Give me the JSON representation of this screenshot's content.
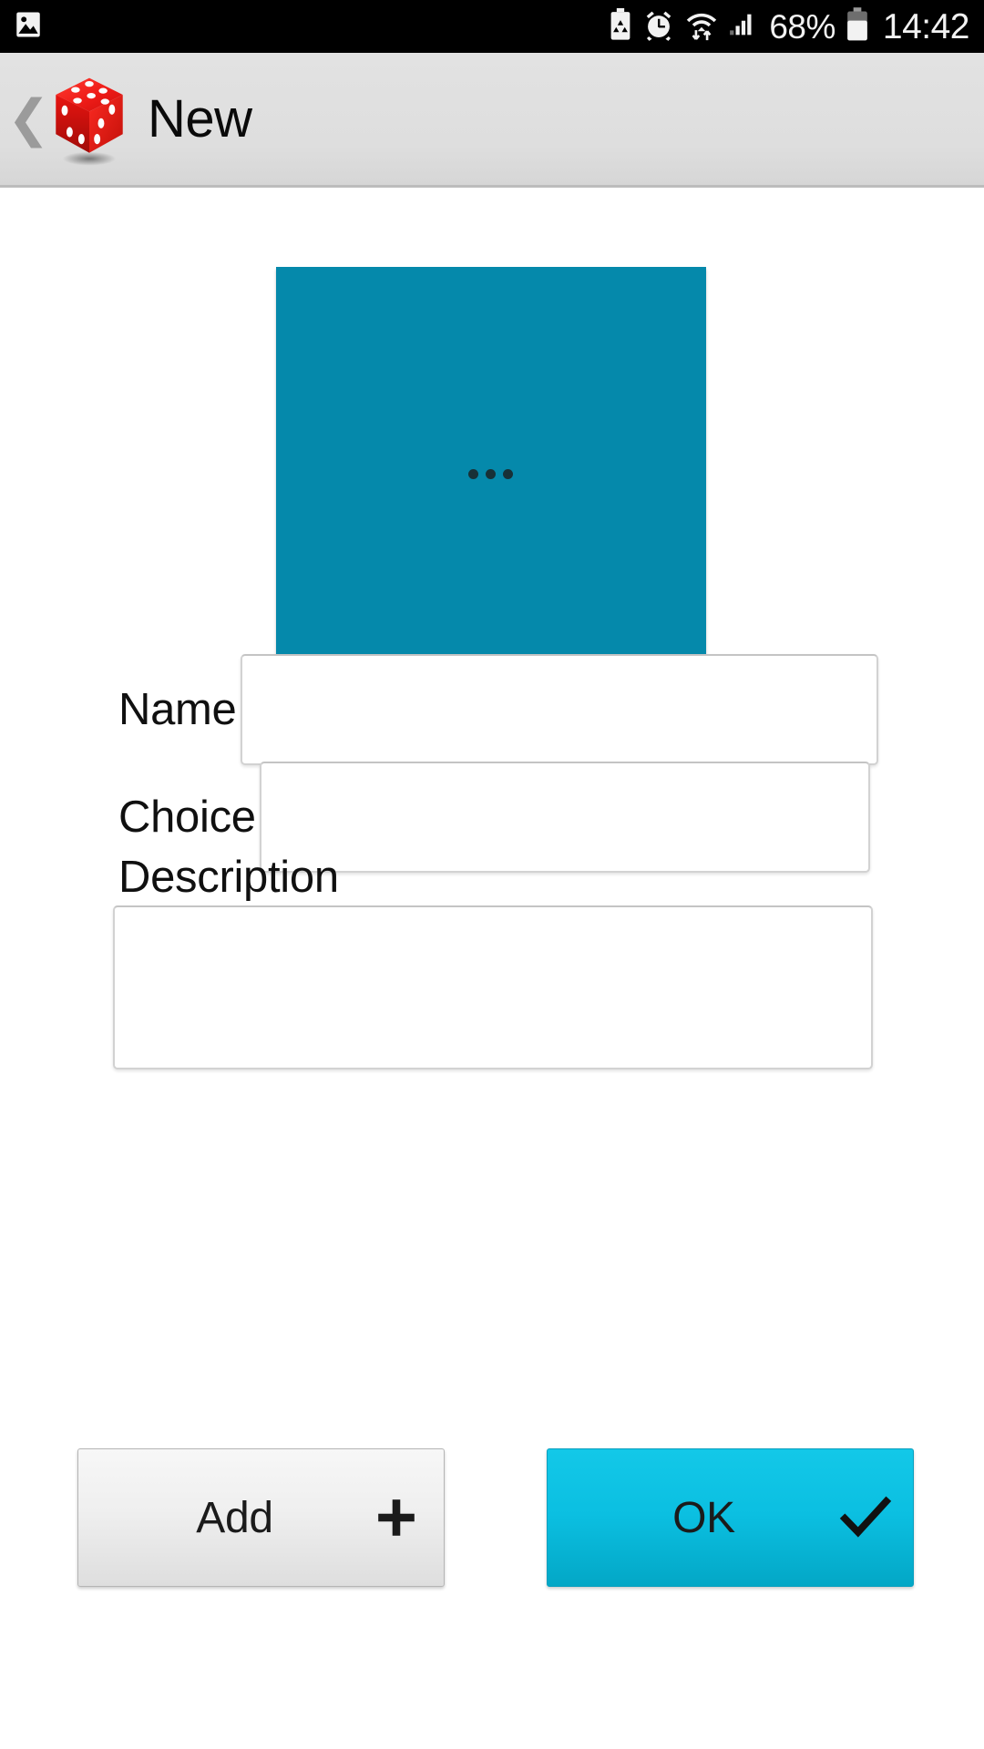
{
  "status_bar": {
    "icons": [
      "image-photo-icon",
      "battery-saver-icon",
      "alarm-clock-icon",
      "wifi-data-transfer-icon",
      "cellular-signal-icon"
    ],
    "battery_percent": "68%",
    "battery_icon": "battery-icon",
    "clock": "14:42"
  },
  "header": {
    "back_icon": "back-chevron-icon",
    "back_glyph": "❮",
    "app_icon": "red-dice-icon",
    "title": "New"
  },
  "main": {
    "image_picker": {
      "name": "image-placeholder",
      "color": "#0589ab",
      "ellipsis_icon": "ellipsis-icon"
    },
    "fields": [
      {
        "id": "name",
        "label": "Name",
        "value": "",
        "placeholder": "",
        "type": "input"
      },
      {
        "id": "choice",
        "label": "Choice",
        "value": "",
        "placeholder": "",
        "type": "input"
      },
      {
        "id": "description",
        "label": "Description",
        "value": "",
        "placeholder": "",
        "type": "textarea"
      }
    ]
  },
  "footer": {
    "buttons": [
      {
        "id": "add",
        "label": "Add",
        "glyph_icon": "plus-icon",
        "color": "#efefef"
      },
      {
        "id": "ok",
        "label": "OK",
        "glyph_icon": "check-icon",
        "color": "#0bbfe1"
      }
    ]
  }
}
